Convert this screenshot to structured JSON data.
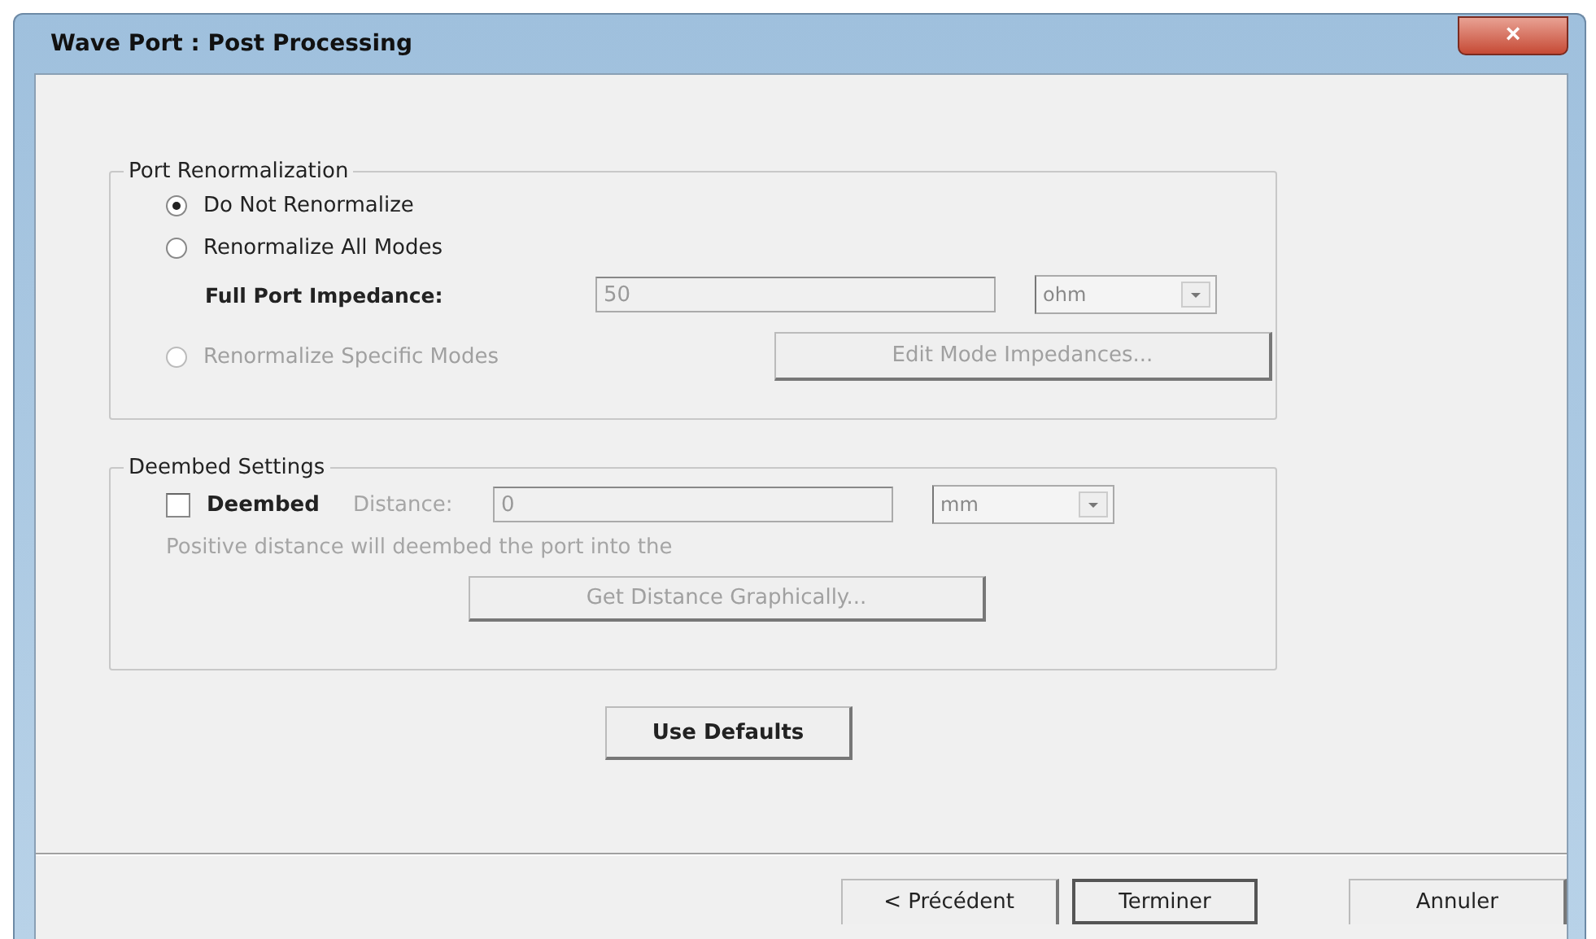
{
  "window": {
    "title": "Wave Port : Post Processing",
    "close": "×"
  },
  "port_renormalization": {
    "legend": "Port Renormalization",
    "options": [
      {
        "label": "Do Not Renormalize",
        "selected": true,
        "disabled": false
      },
      {
        "label": "Renormalize All Modes",
        "selected": false,
        "disabled": false
      },
      {
        "label": "Renormalize Specific Modes",
        "selected": false,
        "disabled": true
      }
    ],
    "impedance": {
      "label": "Full Port Impedance:",
      "value": "50",
      "unit": "ohm",
      "disabled": true
    },
    "edit_button": {
      "label": "Edit Mode Impedances...",
      "disabled": true
    }
  },
  "deembed_settings": {
    "legend": "Deembed Settings",
    "deembed": {
      "label": "Deembed",
      "checked": false
    },
    "distance": {
      "label": "Distance:",
      "value": "0",
      "unit": "mm",
      "disabled": true
    },
    "note": "Positive distance will deembed the port into the",
    "graph_button": {
      "label": "Get Distance Graphically...",
      "disabled": true
    }
  },
  "use_defaults": "Use Defaults",
  "buttons": [
    {
      "label": "< Précédent",
      "default": false
    },
    {
      "label": "Terminer",
      "default": true
    },
    {
      "label": "Annuler",
      "default": false
    }
  ]
}
